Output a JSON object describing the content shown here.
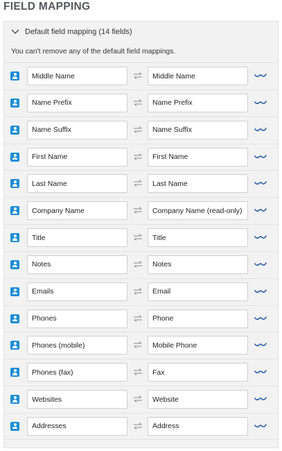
{
  "page": {
    "title": "FIELD MAPPING"
  },
  "panel": {
    "title": "Default field mapping (14 fields)",
    "note": "You can't remove any of the default field mappings."
  },
  "colors": {
    "accent": "#1e8ed6",
    "link_icon": "#2b5fa8",
    "panel_bg": "#f2f2f2"
  },
  "icons": {
    "row_icon": "contact-card-icon",
    "swap": "swap-arrows-icon",
    "mapping": "mapping-link-icon",
    "toggle": "chevron-down-icon"
  },
  "mappings": [
    {
      "source": "Middle Name",
      "target": "Middle Name"
    },
    {
      "source": "Name Prefix",
      "target": "Name Prefix"
    },
    {
      "source": "Name Suffix",
      "target": "Name Suffix"
    },
    {
      "source": "First Name",
      "target": "First Name"
    },
    {
      "source": "Last Name",
      "target": "Last Name"
    },
    {
      "source": "Company Name",
      "target": "Company Name (read-only)"
    },
    {
      "source": "Title",
      "target": "Title"
    },
    {
      "source": "Notes",
      "target": "Notes"
    },
    {
      "source": "Emails",
      "target": "Email"
    },
    {
      "source": "Phones",
      "target": "Phone"
    },
    {
      "source": "Phones (mobile)",
      "target": "Mobile Phone"
    },
    {
      "source": "Phones (fax)",
      "target": "Fax"
    },
    {
      "source": "Websites",
      "target": "Website"
    },
    {
      "source": "Addresses",
      "target": "Address"
    }
  ]
}
